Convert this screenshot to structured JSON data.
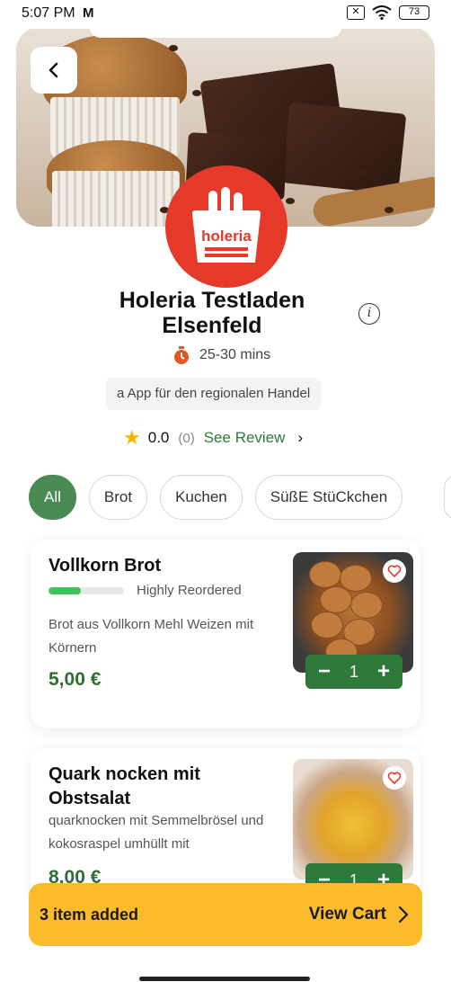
{
  "status_bar": {
    "time": "5:07 PM",
    "mail_icon": "M",
    "battery": "73"
  },
  "store": {
    "name": "Holeria Testladen Elsenfeld",
    "logo_text": "holeria",
    "delivery_time": "25-30 mins",
    "tagline": "a App für den regionalen Handel",
    "rating": "0.0",
    "review_count": "(0)",
    "see_review": "See Review"
  },
  "categories": [
    "All",
    "Brot",
    "Kuchen",
    "SüßE StüCkchen"
  ],
  "products": [
    {
      "title": "Vollkorn Brot",
      "reorder_label": "Highly Reordered",
      "reorder_level": 0.43,
      "description": "Brot aus Vollkorn Mehl Weizen mit Körnern",
      "price": "5,00 €",
      "quantity": "1"
    },
    {
      "title": "Quark nocken mit Obstsalat",
      "description": "quarknocken mit Semmelbrösel und kokosraspel umhüllt mit",
      "price": "8,00 €",
      "quantity": "1"
    }
  ],
  "cart": {
    "count_label": "3 item added",
    "view_label": "View Cart"
  },
  "colors": {
    "accent_green": "#4a8a55",
    "price_green": "#2f6e33",
    "cart_yellow": "#fbbb2a",
    "brand_red": "#e53a2a"
  }
}
